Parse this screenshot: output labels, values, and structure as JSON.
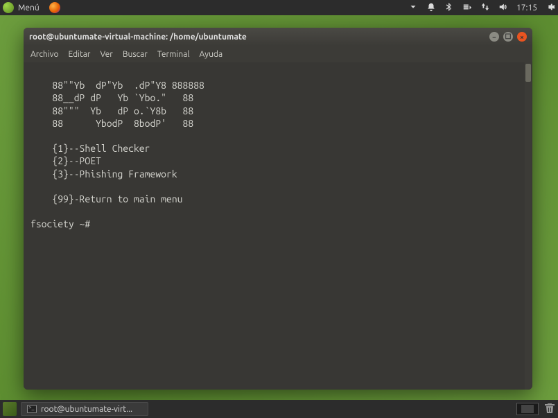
{
  "top_panel": {
    "menu_label": "Menú",
    "clock": "17:15"
  },
  "window": {
    "title": "root@ubuntumate-virtual-machine: /home/ubuntumate",
    "menubar": [
      "Archivo",
      "Editar",
      "Ver",
      "Buscar",
      "Terminal",
      "Ayuda"
    ]
  },
  "terminal": {
    "ascii_line1": "    88\"\"Yb  dP\"Yb  .dP\"Y8 888888",
    "ascii_line2": "    88__dP dP   Yb `Ybo.\"   88",
    "ascii_line3": "    88\"\"\"  Yb   dP o.`Y8b   88",
    "ascii_line4": "    88      YbodP  8bodP'   88",
    "option1": "    {1}--Shell Checker",
    "option2": "    {2}--POET",
    "option3": "    {3}--Phishing Framework",
    "option99": "    {99}-Return to main menu",
    "prompt": "fsociety ~# "
  },
  "bottom_panel": {
    "task_label": "root@ubuntumate-virt..."
  }
}
